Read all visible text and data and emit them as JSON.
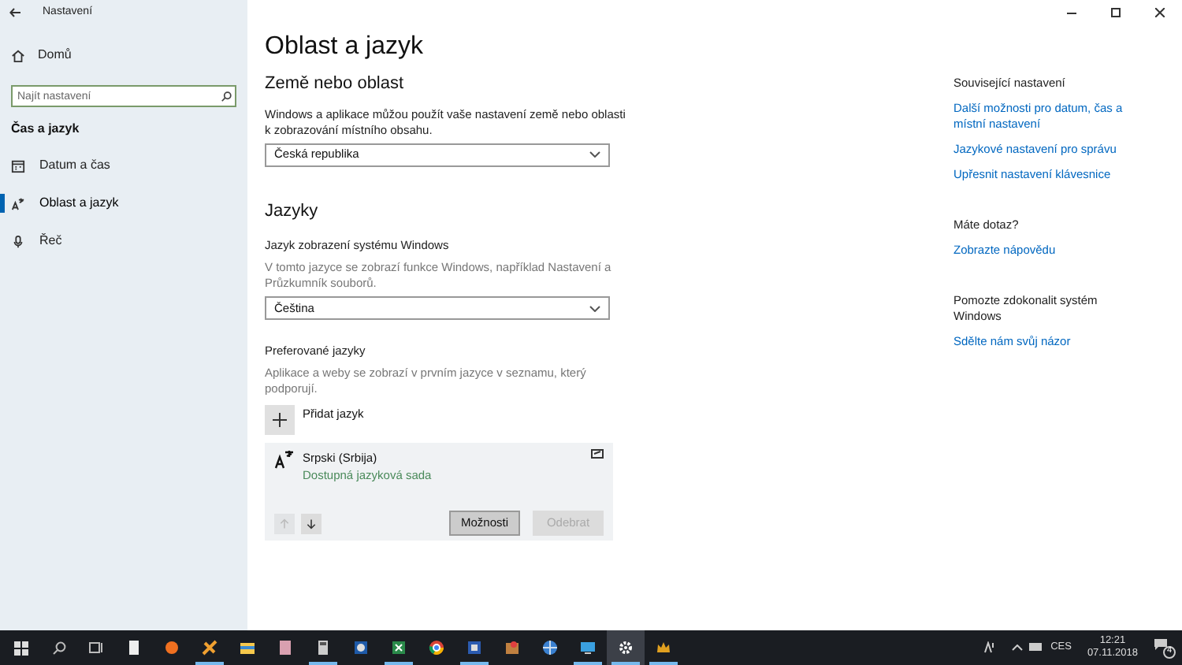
{
  "window": {
    "title": "Nastavení"
  },
  "sidebar": {
    "home": "Domů",
    "search": {
      "placeholder": "Najít nastavení"
    },
    "section": "Čas a jazyk",
    "items": [
      {
        "label": "Datum a čas",
        "kind": "calendar",
        "selected": false
      },
      {
        "label": "Oblast a jazyk",
        "kind": "language",
        "selected": true
      },
      {
        "label": "Řeč",
        "kind": "microphone",
        "selected": false
      }
    ]
  },
  "page": {
    "title": "Oblast a jazyk",
    "region": {
      "heading": "Země nebo oblast",
      "description": "Windows a aplikace můžou použít vaše nastavení země nebo oblasti k zobrazování místního obsahu.",
      "value": "Česká republika"
    },
    "languages": {
      "heading": "Jazyky",
      "display_label": "Jazyk zobrazení systému Windows",
      "display_description": "V tomto jazyce se zobrazí funkce Windows, například Nastavení a Průzkumník souborů.",
      "display_value": "Čeština",
      "preferred_label": "Preferované jazyky",
      "preferred_description": "Aplikace a weby se zobrazí v prvním jazyce v seznamu, který podporují.",
      "add_label": "Přidat jazyk",
      "list": [
        {
          "name": "Srpski (Srbija)",
          "status": "Dostupná jazyková sada",
          "selected": true,
          "buttons": [
            {
              "label": "Možnosti",
              "disabled": false
            },
            {
              "label": "Odebrat",
              "disabled": true
            }
          ],
          "move_up_disabled": true,
          "move_down_disabled": false
        }
      ]
    }
  },
  "related": [
    {
      "heading": "Související nastavení",
      "links": [
        "Další možnosti pro datum, čas a místní nastavení",
        "Jazykové nastavení pro správu",
        "Upřesnit nastavení klávesnice"
      ]
    },
    {
      "heading": "Máte dotaz?",
      "links": [
        "Zobrazte nápovědu"
      ]
    },
    {
      "heading": "Pomozte zdokonalit systém Windows",
      "links": [
        "Sdělte nám svůj názor"
      ]
    }
  ],
  "taskbar": {
    "apps": [
      {
        "kind": "doc",
        "running": false,
        "active": false
      },
      {
        "kind": "avast",
        "running": false,
        "active": false
      },
      {
        "kind": "tool",
        "running": true,
        "active": false
      },
      {
        "kind": "folder",
        "running": false,
        "active": false
      },
      {
        "kind": "notepad",
        "running": false,
        "active": false
      },
      {
        "kind": "calc",
        "running": true,
        "active": false
      },
      {
        "kind": "bluecircle",
        "running": false,
        "active": false
      },
      {
        "kind": "excel",
        "running": true,
        "active": false
      },
      {
        "kind": "chrome",
        "running": false,
        "active": false
      },
      {
        "kind": "word",
        "running": true,
        "active": false
      },
      {
        "kind": "paint",
        "running": false,
        "active": false
      },
      {
        "kind": "globe",
        "running": false,
        "active": false
      },
      {
        "kind": "monitor",
        "running": true,
        "active": false
      },
      {
        "kind": "gear",
        "running": true,
        "active": true
      },
      {
        "kind": "crown",
        "running": true,
        "active": false
      }
    ],
    "language": "CES",
    "time": "12:21",
    "date": "07.11.2018",
    "notifications": "4"
  }
}
